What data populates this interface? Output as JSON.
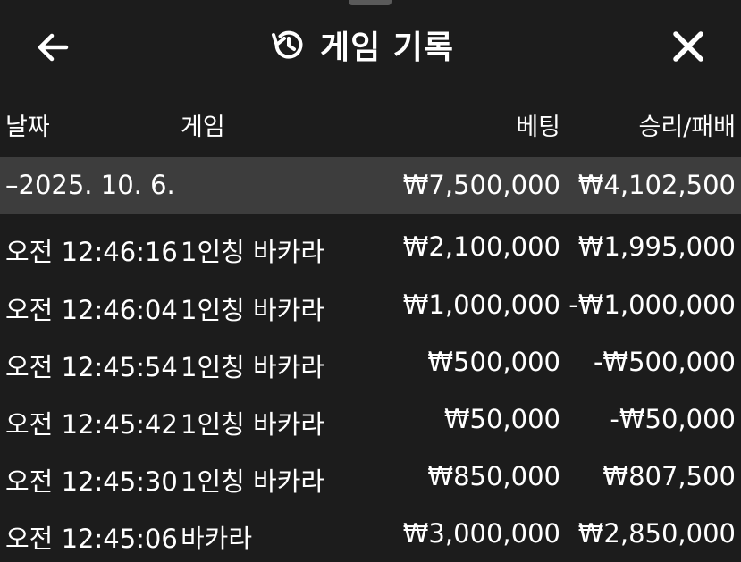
{
  "header": {
    "title": "게임 기록"
  },
  "columns": {
    "date": "날짜",
    "game": "게임",
    "bet": "베팅",
    "result": "승리/패배"
  },
  "group": {
    "date": "–2025. 10. 6.",
    "bet_total": "₩7,500,000",
    "result_total": "₩4,102,500"
  },
  "rows": [
    {
      "time": "오전 12:46:16",
      "game": "1인칭 바카라",
      "bet": "₩2,100,000",
      "result": "₩1,995,000"
    },
    {
      "time": "오전 12:46:04",
      "game": "1인칭 바카라",
      "bet": "₩1,000,000",
      "result": "-₩1,000,000"
    },
    {
      "time": "오전 12:45:54",
      "game": "1인칭 바카라",
      "bet": "₩500,000",
      "result": "-₩500,000"
    },
    {
      "time": "오전 12:45:42",
      "game": "1인칭 바카라",
      "bet": "₩50,000",
      "result": "-₩50,000"
    },
    {
      "time": "오전 12:45:30",
      "game": "1인칭 바카라",
      "bet": "₩850,000",
      "result": "₩807,500"
    },
    {
      "time": "오전 12:45:06",
      "game": "바카라",
      "bet": "₩3,000,000",
      "result": "₩2,850,000"
    }
  ],
  "icons": {
    "back": "arrow-left-icon",
    "history": "history-icon",
    "close": "close-icon"
  }
}
